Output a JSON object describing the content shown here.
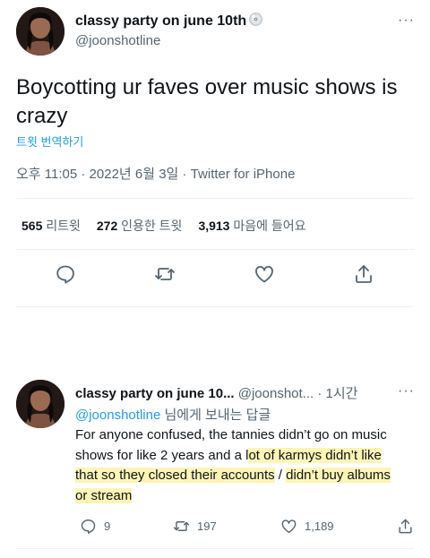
{
  "tweet": {
    "author_name": "classy party on june 10th",
    "author_handle": "@joonshotline",
    "more_label": "···",
    "text": "Boycotting ur faves over music shows is crazy",
    "translate_label": "트윗 번역하기",
    "time": "오후 11:05",
    "date": "2022년 6월 3일",
    "separator": " · ",
    "source": "Twitter for iPhone",
    "stats": {
      "retweets_count": "565",
      "retweets_label": "리트윗",
      "quotes_count": "272",
      "quotes_label": "인용한 트윗",
      "likes_count": "3,913",
      "likes_label": "마음에 들어요"
    },
    "actions": [
      "reply-icon",
      "retweet-icon",
      "like-icon",
      "share-icon"
    ]
  },
  "reply": {
    "author_name": "classy party on june 10...",
    "author_handle": "@joonshot...",
    "separator": " · ",
    "time": "1시간",
    "more_label": "···",
    "replying_to_handle": "@joonshotline",
    "replying_to_suffix": "님에게 보내는 답글",
    "text_part1": "For anyone confused, the tannies didn’t go on music shows for like 2 years and a l",
    "text_part2": "ot of karmys didn’t like that so they closed their accounts",
    "text_part3": " / ",
    "text_part4": "didn’t buy albums or stream",
    "reply_count": "9",
    "retweet_count": "197",
    "like_count": "1,189",
    "highlight_color": "#fdf4b6"
  },
  "colors": {
    "text": "#0f1419",
    "secondary": "#536471",
    "link": "#1d9bf0",
    "divider": "#eff3f4"
  }
}
